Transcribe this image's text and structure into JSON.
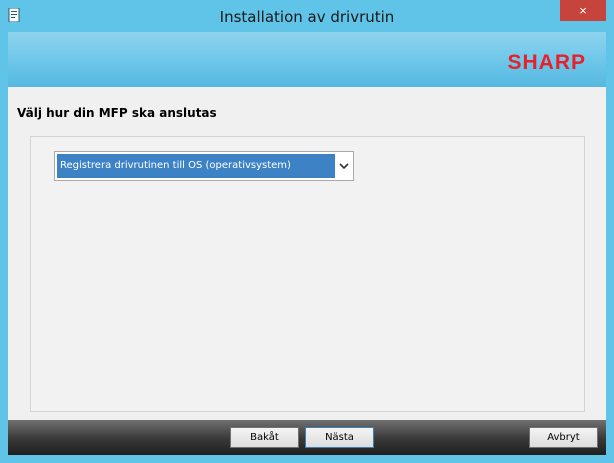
{
  "window": {
    "title": "Installation av drivrutin",
    "close_symbol": "×",
    "icon": "installer-app-icon"
  },
  "banner": {
    "brand": "SHARP"
  },
  "main": {
    "heading": "Välj hur din MFP ska anslutas",
    "dropdown": {
      "selected": "Registrera drivrutinen till OS (operativsystem)",
      "icon": "chevron-down-icon"
    }
  },
  "footer": {
    "back_label": "Bakåt",
    "next_label": "Nästa",
    "cancel_label": "Avbryt"
  },
  "colors": {
    "titlebar": "#5fc4e8",
    "close": "#c7443d",
    "selection": "#3e82c6",
    "brand": "#e8202a"
  }
}
